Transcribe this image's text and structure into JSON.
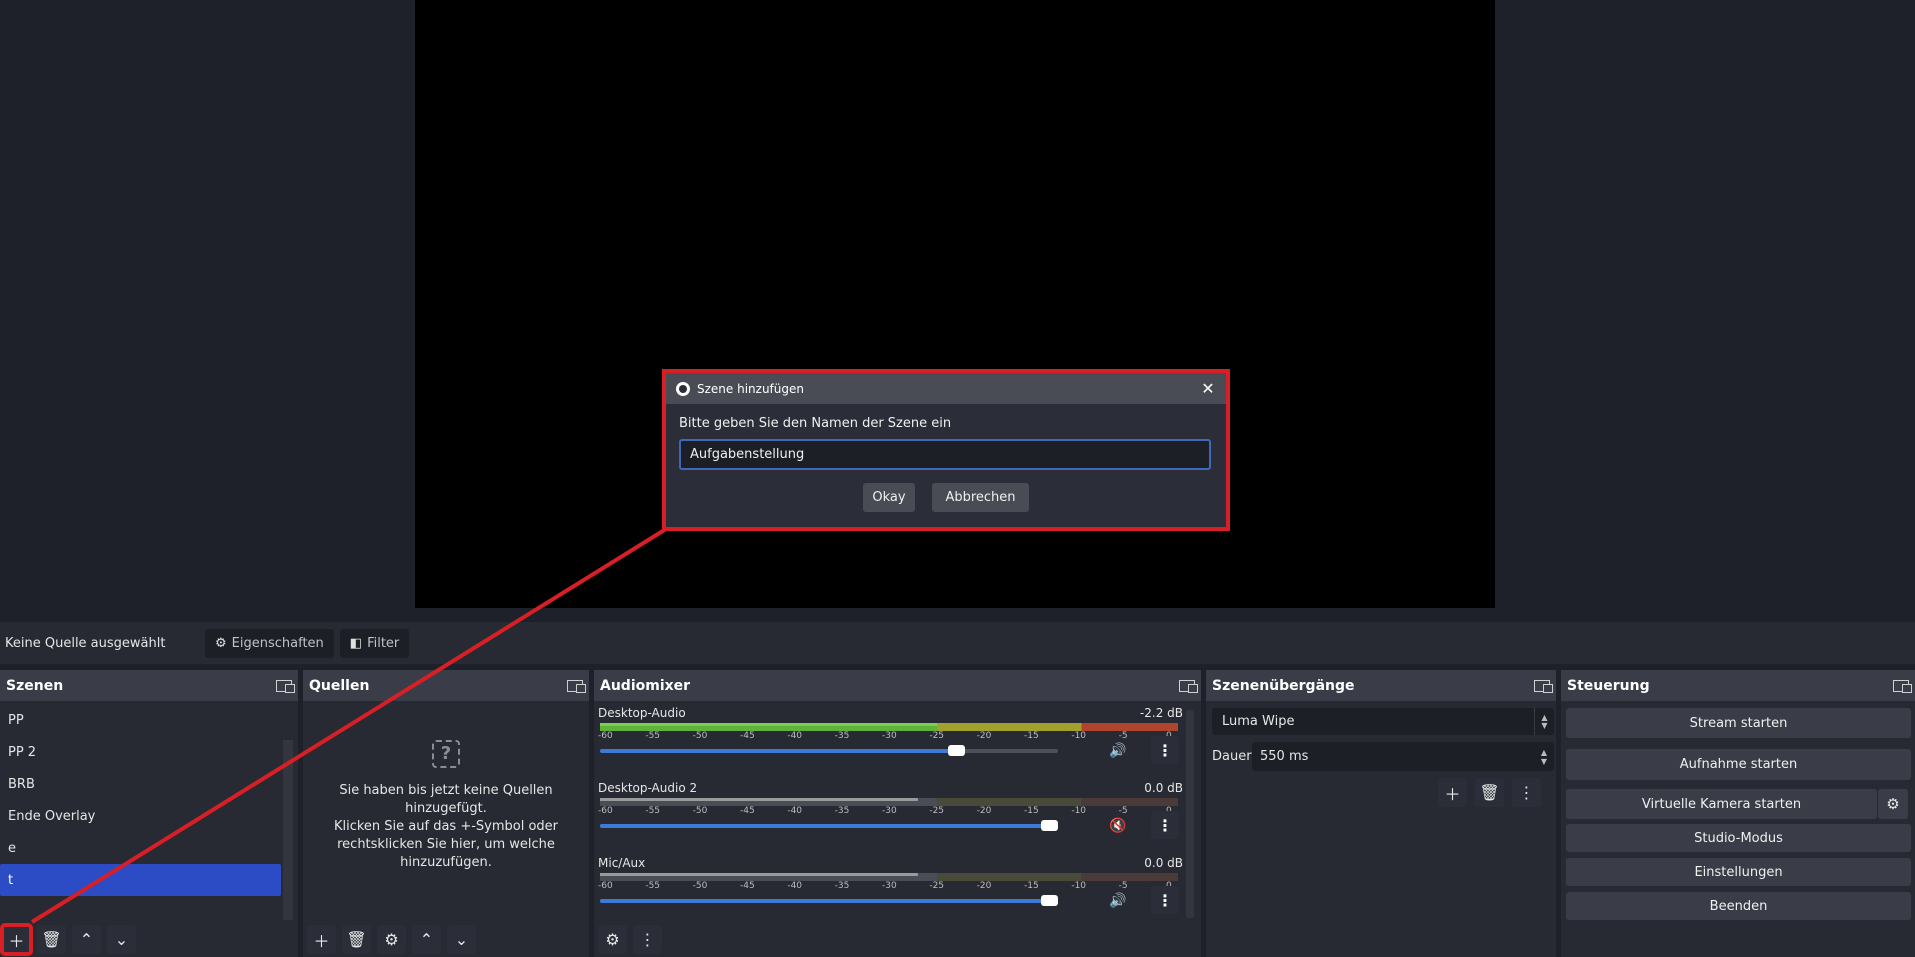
{
  "dialog": {
    "title": "Szene hinzufügen",
    "close_glyph": "✕",
    "prompt": "Bitte geben Sie den Namen der Szene ein",
    "input_value": "Aufgabenstellung",
    "ok_label": "Okay",
    "cancel_label": "Abbrechen"
  },
  "source_toolbar": {
    "no_source_label": "Keine Quelle ausgewählt",
    "properties_label": "Eigenschaften",
    "filter_label": "Filter"
  },
  "scenes": {
    "title": "Szenen",
    "items": [
      {
        "label": "PP"
      },
      {
        "label": "PP 2"
      },
      {
        "label": "BRB"
      },
      {
        "label": "Ende Overlay"
      },
      {
        "label": "e"
      },
      {
        "label": "t",
        "selected": true
      }
    ]
  },
  "sources": {
    "title": "Quellen",
    "empty_line1": "Sie haben bis jetzt keine Quellen",
    "empty_line2": "hinzugefügt.",
    "empty_line3": "Klicken Sie auf das +-Symbol oder",
    "empty_line4": "rechtsklicken Sie hier, um welche",
    "empty_line5": "hinzuzufügen.",
    "qmark": "?"
  },
  "audiomixer": {
    "title": "Audiomixer",
    "tick_labels": [
      "-60",
      "-55",
      "-50",
      "-45",
      "-40",
      "-35",
      "-30",
      "-25",
      "-20",
      "-15",
      "-10",
      "-5",
      "0"
    ],
    "channels": [
      {
        "name": "Desktop-Audio",
        "db": "-2.2 dB",
        "level": 0.96,
        "muted": false,
        "volume": 0.79,
        "meter_active": true
      },
      {
        "name": "Desktop-Audio 2",
        "db": "0.0 dB",
        "level": 1.0,
        "muted": true,
        "volume": 1.0,
        "meter_active": false
      },
      {
        "name": "Mic/Aux",
        "db": "0.0 dB",
        "level": 1.0,
        "muted": false,
        "volume": 1.0,
        "meter_active": false
      }
    ]
  },
  "transitions": {
    "title": "Szenenübergänge",
    "selected": "Luma Wipe",
    "duration_label": "Dauer",
    "duration_value": "550 ms"
  },
  "controls": {
    "title": "Steuerung",
    "stream": "Stream starten",
    "record": "Aufnahme starten",
    "virtual_cam": "Virtuelle Kamera starten",
    "studio_mode": "Studio-Modus",
    "settings": "Einstellungen",
    "exit": "Beenden"
  },
  "colors": {
    "highlight_red": "#d81f26",
    "selection_blue": "#2b4cc4",
    "fader_blue": "#3b7ad6"
  }
}
